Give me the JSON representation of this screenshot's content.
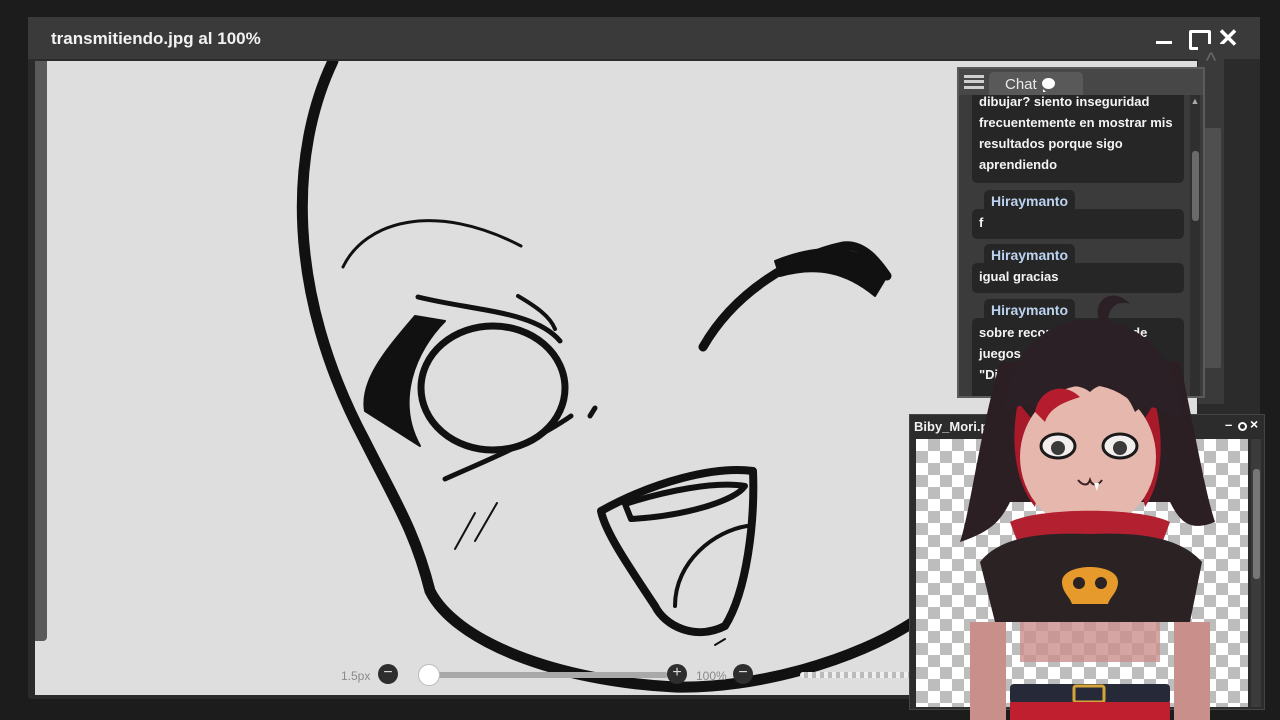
{
  "window": {
    "title": "transmitiendo.jpg al 100%"
  },
  "toolbar": {
    "brush_size": "1.5px",
    "minus": "−",
    "plus": "+",
    "zoom": "100%",
    "zoom_minus": "−"
  },
  "chat": {
    "tab_label": "Chat",
    "messages": [
      {
        "user": "",
        "lines": [
          "dibujar? siento inseguridad",
          "frecuentemente en mostrar mis",
          "resultados porque sigo",
          "aprendiendo"
        ]
      },
      {
        "user": "Hiraymanto",
        "lines": [
          "f"
        ]
      },
      {
        "user": "Hiraymanto",
        "lines": [
          "igual gracias"
        ]
      },
      {
        "user": "Hiraymanto",
        "lines": [
          "sobre recomendaciones de",
          "juegos",
          "\"Di"
        ]
      }
    ]
  },
  "image_window": {
    "title": "Biby_Mori.p",
    "min": "–",
    "close": "×"
  },
  "icons": [
    "minimize-icon",
    "maximize-icon",
    "close-icon",
    "menu-icon",
    "chat-bubble-icon"
  ]
}
